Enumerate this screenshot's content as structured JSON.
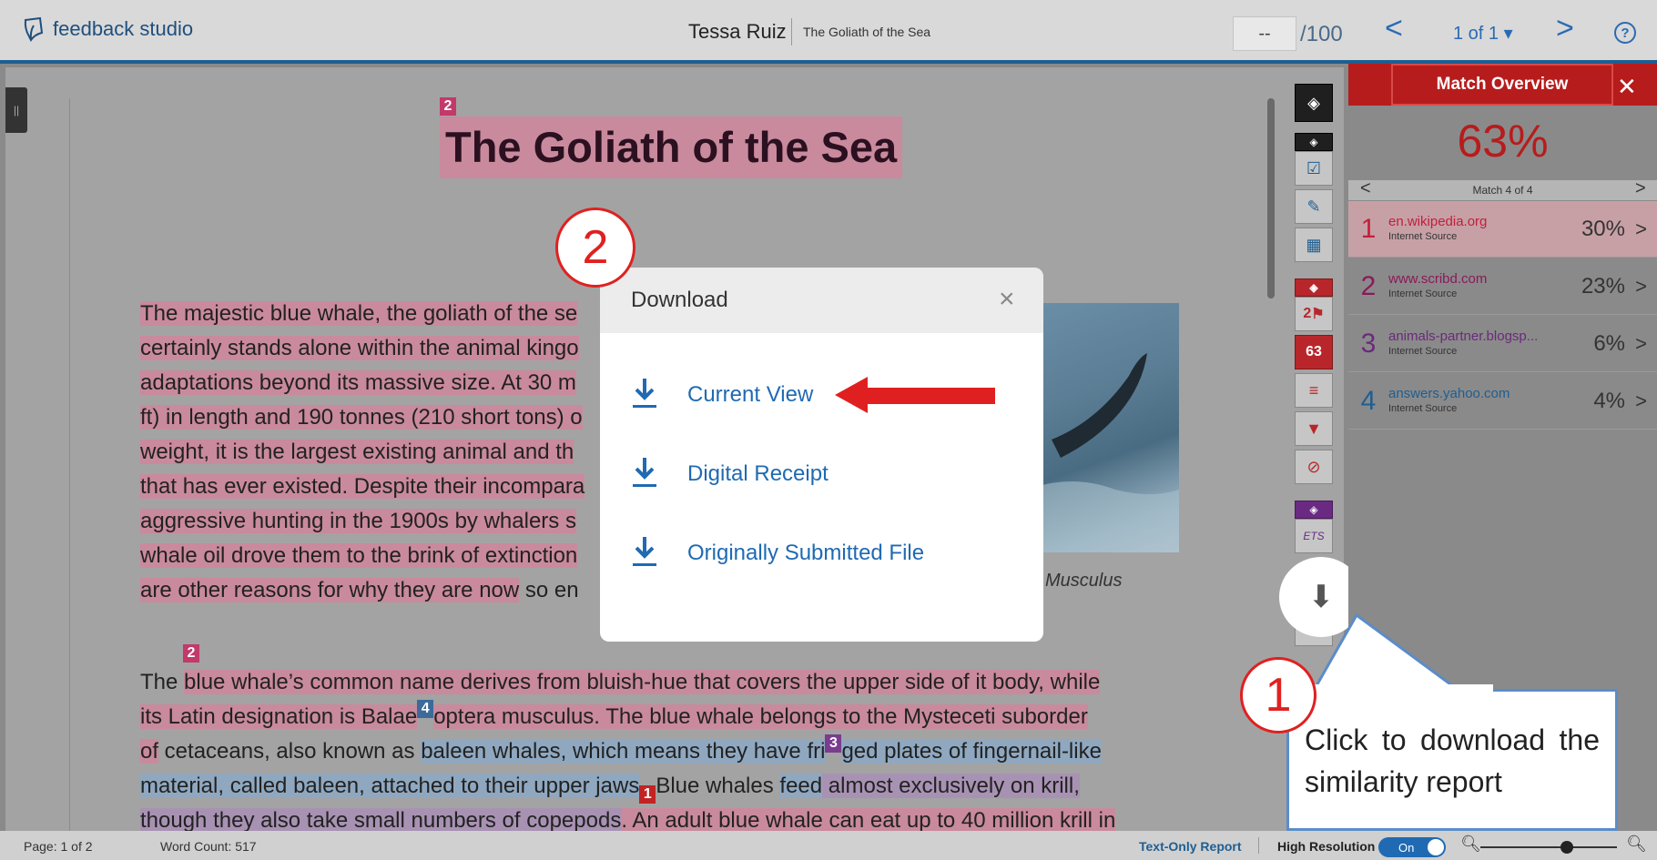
{
  "header": {
    "app_name": "feedback studio",
    "student_name": "Tessa Ruiz",
    "paper_title": "The Goliath of the Sea",
    "score_value": "--",
    "score_max": "/100",
    "page_selector": "1 of 1 ▾",
    "prev_icon": "chevron-left-icon",
    "next_icon": "chevron-right-icon",
    "help_glyph": "?"
  },
  "document": {
    "title": "The Goliath of the Sea",
    "title_marker": "2",
    "para1": [
      "The majestic blue whale, the goliath of the se",
      "certainly stands alone within the animal kingo",
      "adaptations beyond its massive size. At 30 m",
      "ft) in length and 190 tonnes (210 short tons) o",
      "weight, it is the largest existing animal and th",
      "that has ever existed. Despite their incompara",
      "aggressive hunting in the 1900s by whalers s",
      "whale oil drove them to the brink of extinction",
      "are other reasons for why they are now",
      " so en"
    ],
    "para2_marker": "2",
    "para2": {
      "l1a": "The ",
      "l1b": "blue whale’s common name derives from bluish-hue that covers the upper side of it body, while",
      "l2a": "its Latin designation is Balae",
      "l2m": "4",
      "l2b": "optera musculus. The blue whale belongs to the Mysteceti suborder",
      "l3a": "of",
      "l3b": " cetaceans, also known as ",
      "l3c": "baleen whales, which means they have fri",
      "l3m": "3",
      "l3d": "ged plates of fingernail-like",
      "l4a": "material, called baleen, attached to their upper jaws",
      "l4m": "1",
      "l4b": "Blue whales ",
      "l4c": "feed",
      "l4d": " almost exclusively on krill,",
      "l5a": "though they also take small numbers of copepods",
      "l5b": ". An adult blue whale can eat up to 40 million krill in"
    },
    "image_caption": "Musculus"
  },
  "tools": {
    "download_icon": "download-icon",
    "download_glyph": "⬇"
  },
  "side_panel": {
    "title": "Match Overview",
    "similarity": "63%",
    "match_nav": "Match 4 of 4",
    "sources": [
      {
        "num": "1",
        "name": "en.wikipedia.org",
        "type": "Internet Source",
        "pct": "30%",
        "color": "#c0203a"
      },
      {
        "num": "2",
        "name": "www.scribd.com",
        "type": "Internet Source",
        "pct": "23%",
        "color": "#8a1a5a"
      },
      {
        "num": "3",
        "name": "animals-partner.blogsp...",
        "type": "Internet Source",
        "pct": "6%",
        "color": "#6a2a7a"
      },
      {
        "num": "4",
        "name": "answers.yahoo.com",
        "type": "Internet Source",
        "pct": "4%",
        "color": "#1f5e91"
      }
    ]
  },
  "tool_rail": {
    "flag_count": "2",
    "score_badge": "63"
  },
  "bottom_bar": {
    "page_count": "Page: 1 of 2",
    "word_count": "Word Count: 517",
    "text_only": "Text-Only Report",
    "high_res": "High Resolution",
    "toggle_label": "On"
  },
  "modal": {
    "title": "Download",
    "close": "×",
    "items": [
      "Current View",
      "Digital Receipt",
      "Originally Submitted File"
    ]
  },
  "annotations": {
    "step1": "1",
    "step2": "2",
    "callout": "Click to download the similarity report",
    "arrow_color": "#e02020",
    "callout_border": "#5b8cc8"
  }
}
